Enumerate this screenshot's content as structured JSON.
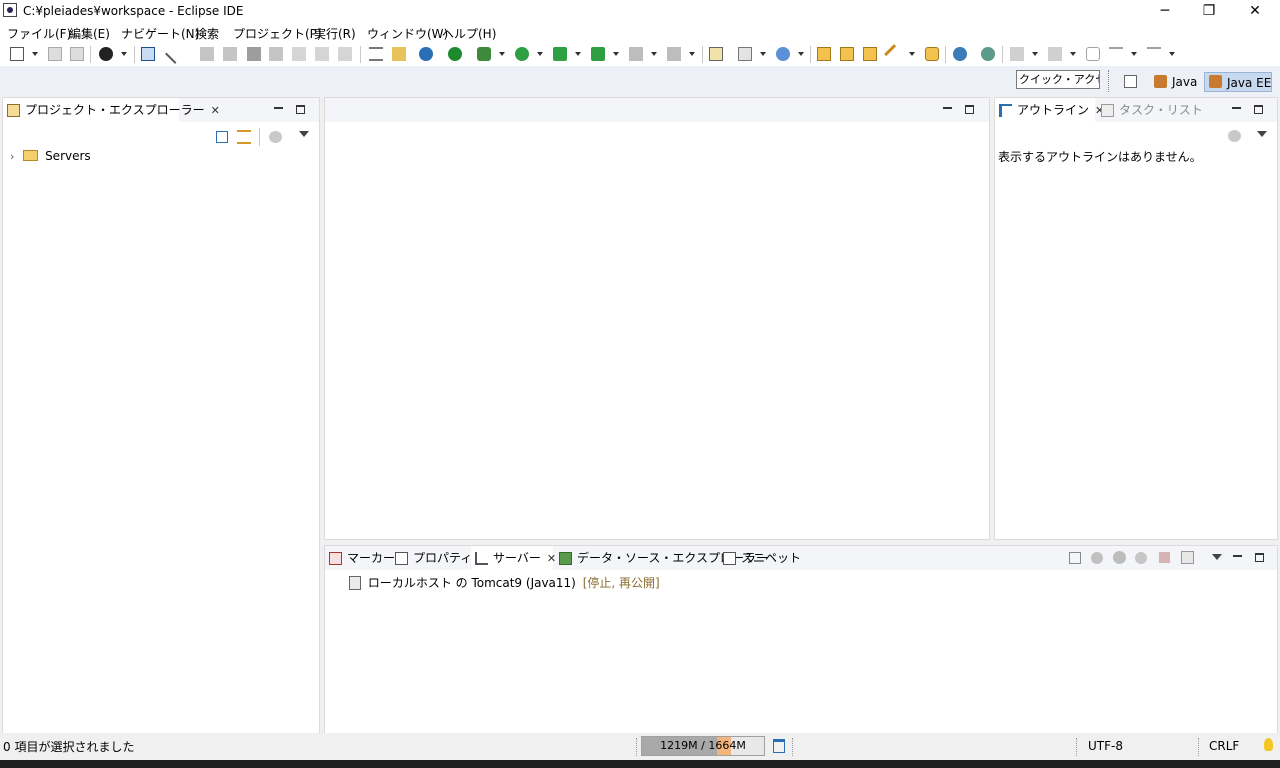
{
  "window": {
    "title": "C:¥pleiades¥workspace - Eclipse IDE",
    "minimize": "─",
    "restore": "❐",
    "close": "✕"
  },
  "menu": [
    "ファイル(F)",
    "編集(E)",
    "ナビゲート(N)",
    "検索",
    "プロジェクト(P)",
    "実行(R)",
    "ウィンドウ(W)",
    "ヘルプ(H)"
  ],
  "perspectives": {
    "quick_access": "クイック・アクセス",
    "java": "Java",
    "java_ee": "Java EE"
  },
  "project_explorer": {
    "tab_label": "プロジェクト・エクスプローラー",
    "tree": [
      {
        "label": "Servers",
        "icon": "folder-icon"
      }
    ]
  },
  "outline": {
    "tab_label": "アウトライン",
    "tab2_label": "タスク・リスト",
    "empty_message": "表示するアウトラインはありません。"
  },
  "bottom_panel": {
    "tabs": [
      "マーカー",
      "プロパティー",
      "サーバー",
      "データ・ソース・エクスプローラー",
      "スニペット"
    ],
    "active_tab": "サーバー",
    "servers": [
      {
        "name": "ローカルホスト の Tomcat9 (Java11)",
        "status": "[停止, 再公開]"
      }
    ]
  },
  "status": {
    "selection": "0 項目が選択されました",
    "heap": "1219M / 1664M",
    "heap_used_fraction": 0.733,
    "encoding": "UTF-8",
    "line_ending": "CRLF"
  },
  "colors": {
    "accent": "#2a6fb6",
    "status_text": "#8b6d2f",
    "heap_fill": "#a9a9a9",
    "heap_recent": "#f6b47d"
  }
}
